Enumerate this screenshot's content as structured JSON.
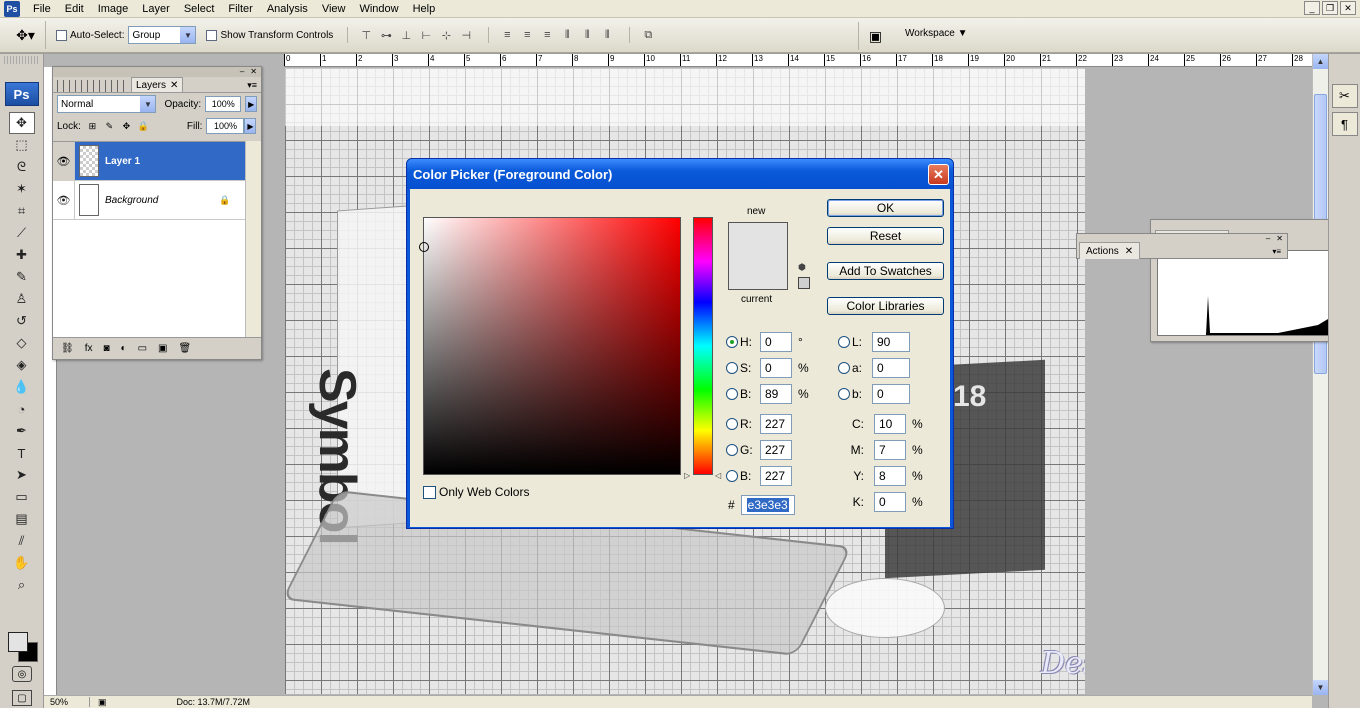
{
  "menu": [
    "File",
    "Edit",
    "Image",
    "Layer",
    "Select",
    "Filter",
    "Analysis",
    "View",
    "Window",
    "Help"
  ],
  "options": {
    "auto_select_label": "Auto-Select:",
    "auto_select_value": "Group",
    "transform_label": "Show Transform Controls",
    "workspace_label": "Workspace"
  },
  "ruler": [
    "0",
    "1",
    "2",
    "3",
    "4",
    "5",
    "6",
    "7",
    "8",
    "9",
    "10",
    "11",
    "12",
    "13",
    "14",
    "15",
    "16",
    "17",
    "18",
    "19",
    "20",
    "21",
    "22",
    "23",
    "24",
    "25",
    "26",
    "27",
    "28"
  ],
  "canvas": {
    "book_text": "Symbol",
    "calendar_number": "18",
    "watermark": "DesignOptimal.com"
  },
  "status": {
    "zoom": "50%",
    "doc_info": "Doc: 13.7M/7.72M"
  },
  "layers": {
    "tab_label": "Layers",
    "blend_mode": "Normal",
    "opacity_label": "Opacity:",
    "opacity_value": "100%",
    "lock_label": "Lock:",
    "fill_label": "Fill:",
    "fill_value": "100%",
    "items": [
      {
        "name": "Layer 1"
      },
      {
        "name": "Background"
      }
    ]
  },
  "actions": {
    "tab_label": "Actions"
  },
  "picker": {
    "title": "Color Picker (Foreground Color)",
    "new_label": "new",
    "current_label": "current",
    "ok": "OK",
    "reset": "Reset",
    "add_swatches": "Add To Swatches",
    "color_libraries": "Color Libraries",
    "only_web": "Only Web Colors",
    "hex_label": "#",
    "hex": "e3e3e3",
    "current_color": "#e3e3e3",
    "hsb": {
      "h_label": "H:",
      "h": "0",
      "h_unit": "°",
      "s_label": "S:",
      "s": "0",
      "s_unit": "%",
      "b_label": "B:",
      "b": "89",
      "b_unit": "%"
    },
    "rgb": {
      "r_label": "R:",
      "r": "227",
      "g_label": "G:",
      "g": "227",
      "b_label": "B:",
      "b": "227"
    },
    "lab": {
      "l_label": "L:",
      "l": "90",
      "a_label": "a:",
      "a": "0",
      "b_label": "b:",
      "b": "0"
    },
    "cmyk": {
      "c_label": "C:",
      "c": "10",
      "m_label": "M:",
      "m": "7",
      "y_label": "Y:",
      "y": "8",
      "k_label": "K:",
      "k": "0",
      "unit": "%"
    }
  }
}
